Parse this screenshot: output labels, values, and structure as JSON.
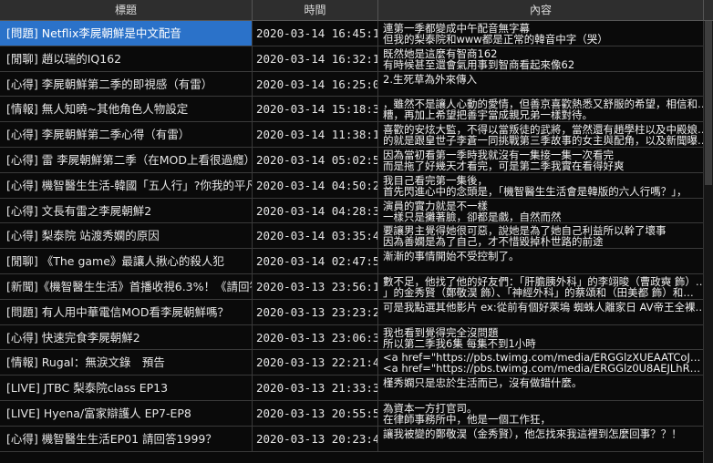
{
  "header": {
    "title": "標題",
    "time": "時間",
    "content": "內容"
  },
  "rows": [
    {
      "title": "[問題] Netflix李屍朝鮮是中文配音",
      "time": "2020-03-14 16:45:18",
      "content": [
        "連第一季都變成中午配音無字幕",
        "但我的梨泰院和www都是正常的韓音中字（哭）"
      ]
    },
    {
      "title": "[閒聊] 趙以瑞的IQ162",
      "time": "2020-03-14 16:32:16",
      "content": [
        "既然她是這麼有智商162",
        "有時候甚至還會氣用事到智商看起來像62"
      ]
    },
    {
      "title": "[心得] 李屍朝鮮第二季的即視感（有雷）",
      "time": "2020-03-14 16:25:08",
      "content": [
        "2.生死草為外來傳入"
      ]
    },
    {
      "title": "[情報] 無人知曉~其他角色人物設定",
      "time": "2020-03-14 15:18:31",
      "content": [
        "，雖然不是讓人心動的愛情，但善京喜歡熱悉又舒服的希望，相信和…",
        "糟，再加上希望把善宇當成親兄弟一樣對待。"
      ]
    },
    {
      "title": "[心得] 李屍朝鮮第二季心得（有雷）",
      "time": "2020-03-14 11:38:16",
      "content": [
        "喜歡的安炫大監，不得以當叛徒的武將，當然還有趙學柱以及中殿娘…",
        "的就是跟皇世子李蒼一同挑戰第三季故事的女主與配角，以及新聞曝…"
      ]
    },
    {
      "title": "[心得] 雷 李屍朝鮮第二季（在MOD上看很過癮）",
      "time": "2020-03-14 05:02:52",
      "content": [
        "因為當初看第一季時我就沒有一集接一集一次看完",
        "而是拖了好幾天才看完，可是第二季我實在看得好爽"
      ]
    },
    {
      "title": "[心得] 機智醫生生活-韓國「五人行」?你我的平凡",
      "time": "2020-03-14 04:50:27",
      "content": [
        "我目己看完第一集後，",
        "首先閃進心中的念頭是，「機智醫生生活會是韓版的六人行嗎？」，"
      ]
    },
    {
      "title": "[心得] 文長有雷之李屍朝鮮2",
      "time": "2020-03-14 04:28:38",
      "content": [
        "演員的實力就是不一樣",
        "一樣只是攤著臉，卻都是戲，自然而然"
      ]
    },
    {
      "title": "[心得] 梨泰院 站渡秀嫻的原因",
      "time": "2020-03-14 03:35:41",
      "content": [
        "要讓男主覺得她很可惡，說她是為了她自己利益所以幹了壞事",
        "因為善嫻是為了自己，才不惜毀掉朴世路的前途"
      ]
    },
    {
      "title": "[閒聊] 《The game》最讓人揪心的殺人犯",
      "time": "2020-03-14 02:47:57",
      "content": [
        "漸漸的事情開始不受控制了。"
      ]
    },
    {
      "title": "[新聞]《機智醫生生活》首播收視6.3%！《請回答",
      "time": "2020-03-13 23:56:11",
      "content": [
        "數不足，他找了他的好友們：「肝膽胰外科」的李翊晙（曹政奭 飾）…",
        "」的金秀賢（鄭敬淏 飾）、「神經外科」的蔡頌和（田美都 飾）和…"
      ]
    },
    {
      "title": "[問題] 有人用中華電信MOD看李屍朝鮮嗎？",
      "time": "2020-03-13 23:23:22",
      "content": [
        "可是我點選其他影片 ex:從前有個好萊塢 蜘蛛人離家日 AV帝王全裸…"
      ]
    },
    {
      "title": "[心得] 快速完食李屍朝鮮2",
      "time": "2020-03-13 23:06:37",
      "content": [
        "我也看到覺得完全沒問題",
        "所以第二季我6集 每集不到1小時"
      ]
    },
    {
      "title": "[情報] Rugal：無淚文錄　預告",
      "time": "2020-03-13 22:21:46",
      "content": [
        "<a href=\"https://pbs.twimg.com/media/ERGGlzXUEAATCoJ…",
        "<a href=\"https://pbs.twimg.com/media/ERGGlz0U8AEJLhR…"
      ]
    },
    {
      "title": "[LIVE] JTBC 梨泰院class EP13",
      "time": "2020-03-13 21:33:32",
      "content": [
        "槿秀嫻只是忠於生活而已，沒有做錯什麼。"
      ]
    },
    {
      "title": "[LIVE] Hyena/富家辯護人 EP7-EP8",
      "time": "2020-03-13 20:55:53",
      "content": [
        "為資本一方打官司。",
        "在律師事務所中，他是一個工作狂，"
      ]
    },
    {
      "title": "[心得] 機智醫生生活EP01 請回答1999？",
      "time": "2020-03-13 20:23:42",
      "content": [
        "讓我被變的鄭敬淏（金秀賢），他怎找來我這裡到怎麼回事？？！"
      ]
    }
  ]
}
